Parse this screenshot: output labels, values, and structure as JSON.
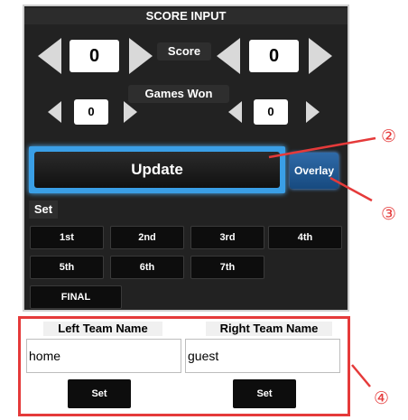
{
  "panel": {
    "title": "SCORE INPUT",
    "score_label": "Score",
    "games_label": "Games Won",
    "score_left": "0",
    "score_right": "0",
    "games_left": "0",
    "games_right": "0",
    "update_label": "Update",
    "overlay_label": "Overlay",
    "set_label": "Set",
    "set_buttons": [
      "1st",
      "2nd",
      "3rd",
      "4th",
      "5th",
      "6th",
      "7th",
      "FINAL"
    ]
  },
  "teams": {
    "left_header": "Left Team Name",
    "right_header": "Right Team Name",
    "left_value": "home",
    "right_value": "guest",
    "left_set": "Set",
    "right_set": "Set"
  },
  "callouts": [
    "②",
    "③",
    "④"
  ],
  "colors": {
    "panel_bg": "#222222",
    "update_glow": "#3a9fe6",
    "overlay_bg": "#2f6aa8",
    "callout_red": "#e53a3a"
  },
  "icons": {
    "decrement": "left-triangle-icon",
    "increment": "right-triangle-icon"
  }
}
